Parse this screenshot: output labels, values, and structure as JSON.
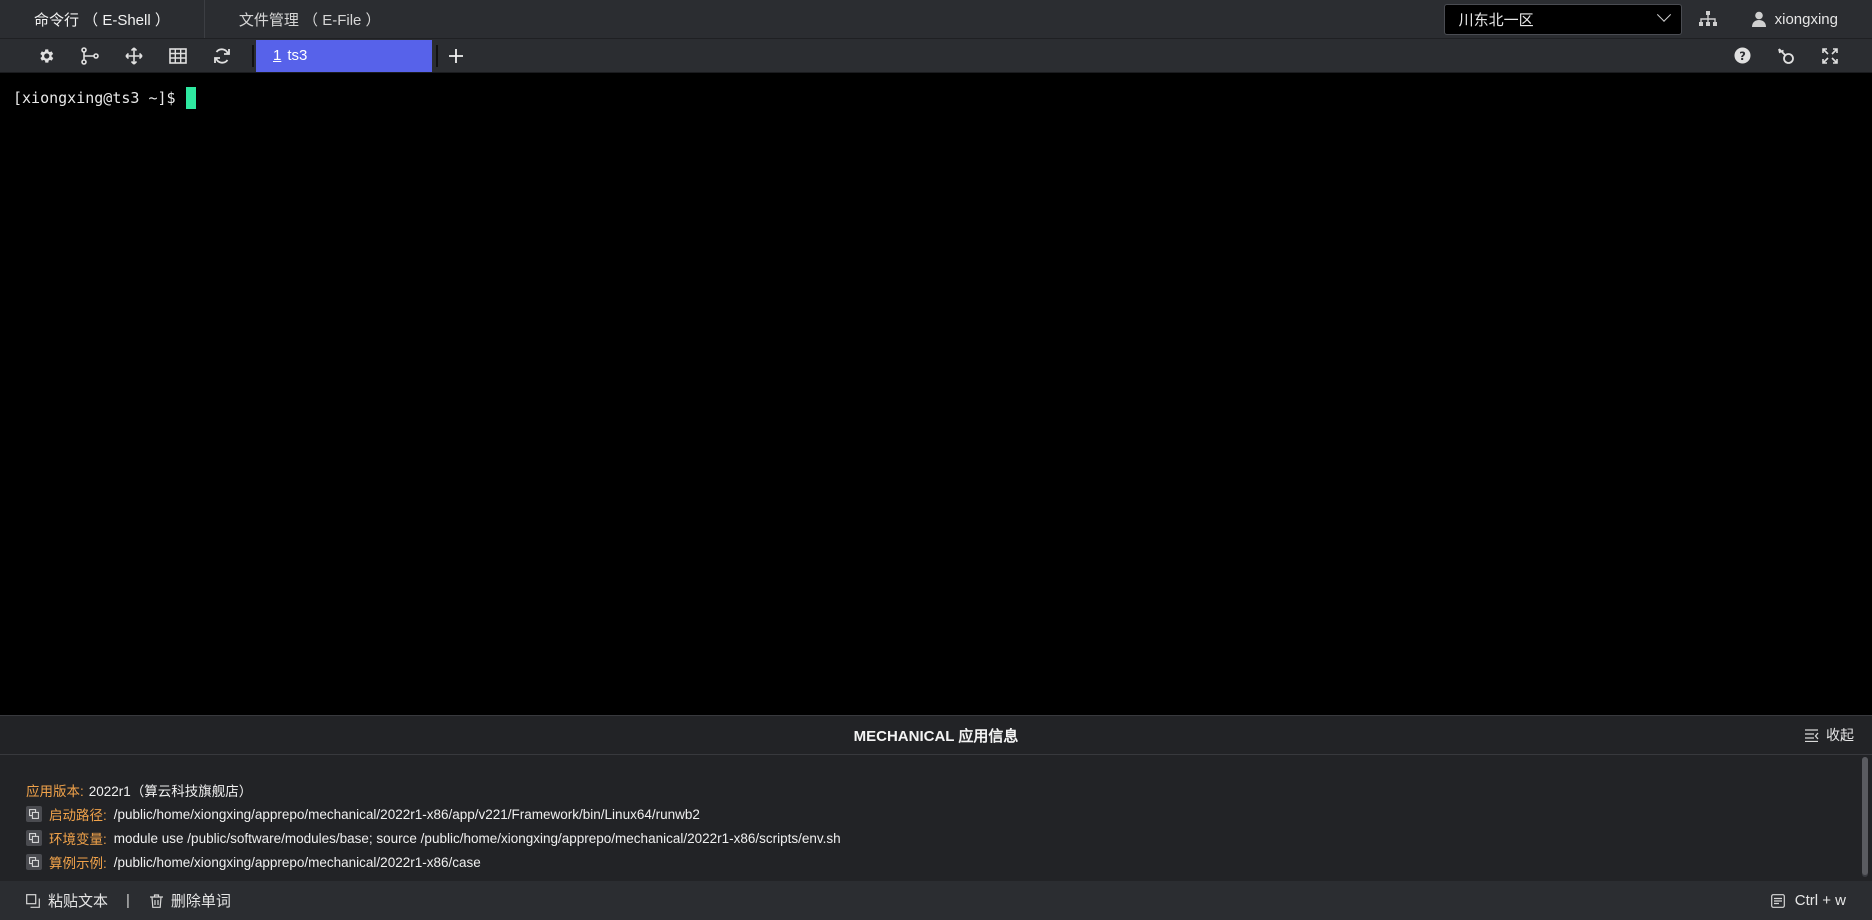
{
  "header": {
    "tabs": [
      {
        "label": "命令行 （ E-Shell ）",
        "active": true
      },
      {
        "label": "文件管理 （ E-File ）",
        "active": false
      }
    ],
    "region": "川东北一区",
    "username": "xiongxing"
  },
  "toolbar": {
    "left_icons": [
      "gear-icon",
      "branch-icon",
      "move-icon",
      "grid-icon",
      "refresh-icon"
    ],
    "session_tab": {
      "number": "1",
      "name": "ts3"
    },
    "add_label": "+",
    "right_icons": [
      "help-icon",
      "key-icon",
      "fullscreen-icon"
    ]
  },
  "terminal": {
    "prompt": "[xiongxing@ts3 ~]$",
    "cursor_color": "#2ee8a0"
  },
  "app_info": {
    "title": "MECHANICAL 应用信息",
    "collapse_label": "收起",
    "rows": [
      {
        "label": "应用版本:",
        "value": "2022r1（算云科技旗舰店）",
        "copyable": false
      },
      {
        "label": "启动路径:",
        "value": "/public/home/xiongxing/apprepo/mechanical/2022r1-x86/app/v221/Framework/bin/Linux64/runwb2",
        "copyable": true
      },
      {
        "label": "环境变量:",
        "value": "module use /public/software/modules/base; source /public/home/xiongxing/apprepo/mechanical/2022r1-x86/scripts/env.sh",
        "copyable": true
      },
      {
        "label": "算例示例:",
        "value": "/public/home/xiongxing/apprepo/mechanical/2022r1-x86/case",
        "copyable": true
      }
    ]
  },
  "bottombar": {
    "paste_label": "粘贴文本",
    "separator": "|",
    "delete_label": "删除单词",
    "shortcut_label": "Ctrl + w"
  },
  "colors": {
    "accent": "#5762ea",
    "label": "#f0a24a",
    "background": "#2b2d31"
  }
}
